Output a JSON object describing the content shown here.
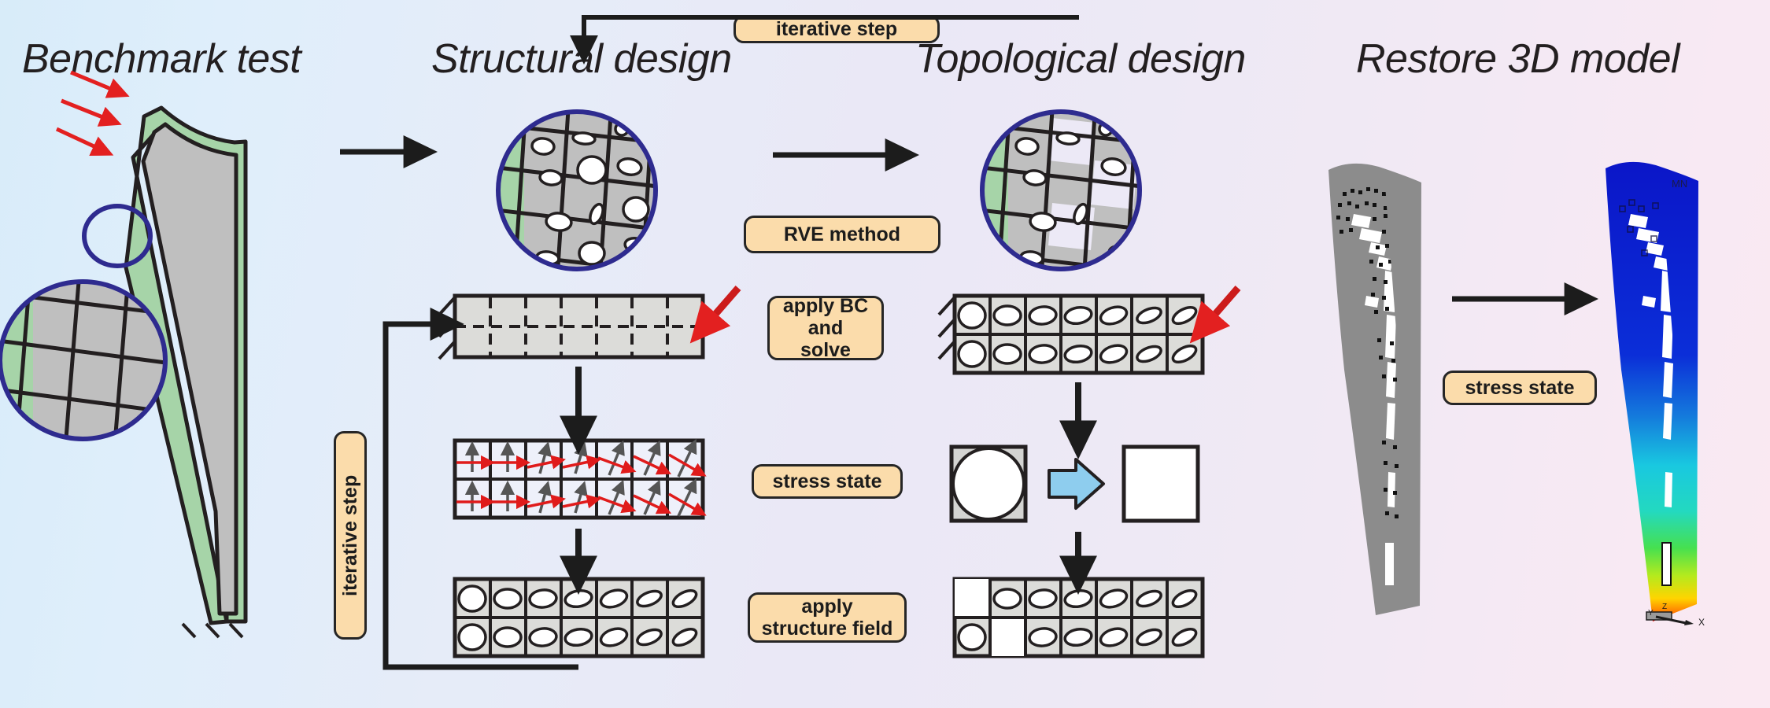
{
  "figure": {
    "title_benchmark": "Benchmark test",
    "title_structural": "Structural design",
    "title_topological": "Topological design",
    "title_restore": "Restore 3D model"
  },
  "badges": {
    "iterative_step_top": "iterative step",
    "iterative_step_left": "iterative step",
    "rve_method": "RVE method",
    "apply_bc_and_solve": "apply BC\nand solve",
    "apply_bc_line1": "apply BC",
    "apply_bc_line2": "and solve",
    "stress_state_center": "stress state",
    "apply_structure_field_line1": "apply",
    "apply_structure_field_line2": "structure field",
    "stress_state_right": "stress state"
  },
  "fea": {
    "min_label": "MN",
    "axis_x": "X",
    "axis_y": "Y",
    "axis_z": "Z"
  },
  "colors": {
    "badge_fill": "#fbdcab",
    "badge_border": "#262626",
    "circle_callout_stroke": "#2e2b8f",
    "coating_green": "#a6d4a8",
    "blade_gray": "#bfbfbf",
    "cell_gray": "#d4d4d2",
    "load_arrow_red": "#e32020",
    "flow_arrow_black": "#1c1c1c",
    "transform_arrow_blue": "#8ecdee",
    "stress_arrow_gray": "#555555",
    "stress_arrow_red": "#e01b1b",
    "bg_left": "#d8ecf9",
    "bg_mid": "#eae8f6",
    "bg_right": "#fae9f2",
    "fea_hot": "#ff0000",
    "fea_cold": "#0000cd"
  },
  "grid_structural": {
    "cols": 7,
    "rows": 2,
    "note": "structural mesh bar with dashed interior element edges"
  },
  "grid_topological": {
    "cols": 7,
    "rows": 2,
    "note": "cells hold ellipses flattening and rotating left to right"
  },
  "structure_field_removed_cells": [
    {
      "row": 0,
      "col": 0
    },
    {
      "row": 1,
      "col": 1
    }
  ],
  "stress_cells": {
    "cols": 7,
    "rows": 2,
    "note": "each cell shows a gray principal arrow and a red principal arrow rotating progressively"
  }
}
